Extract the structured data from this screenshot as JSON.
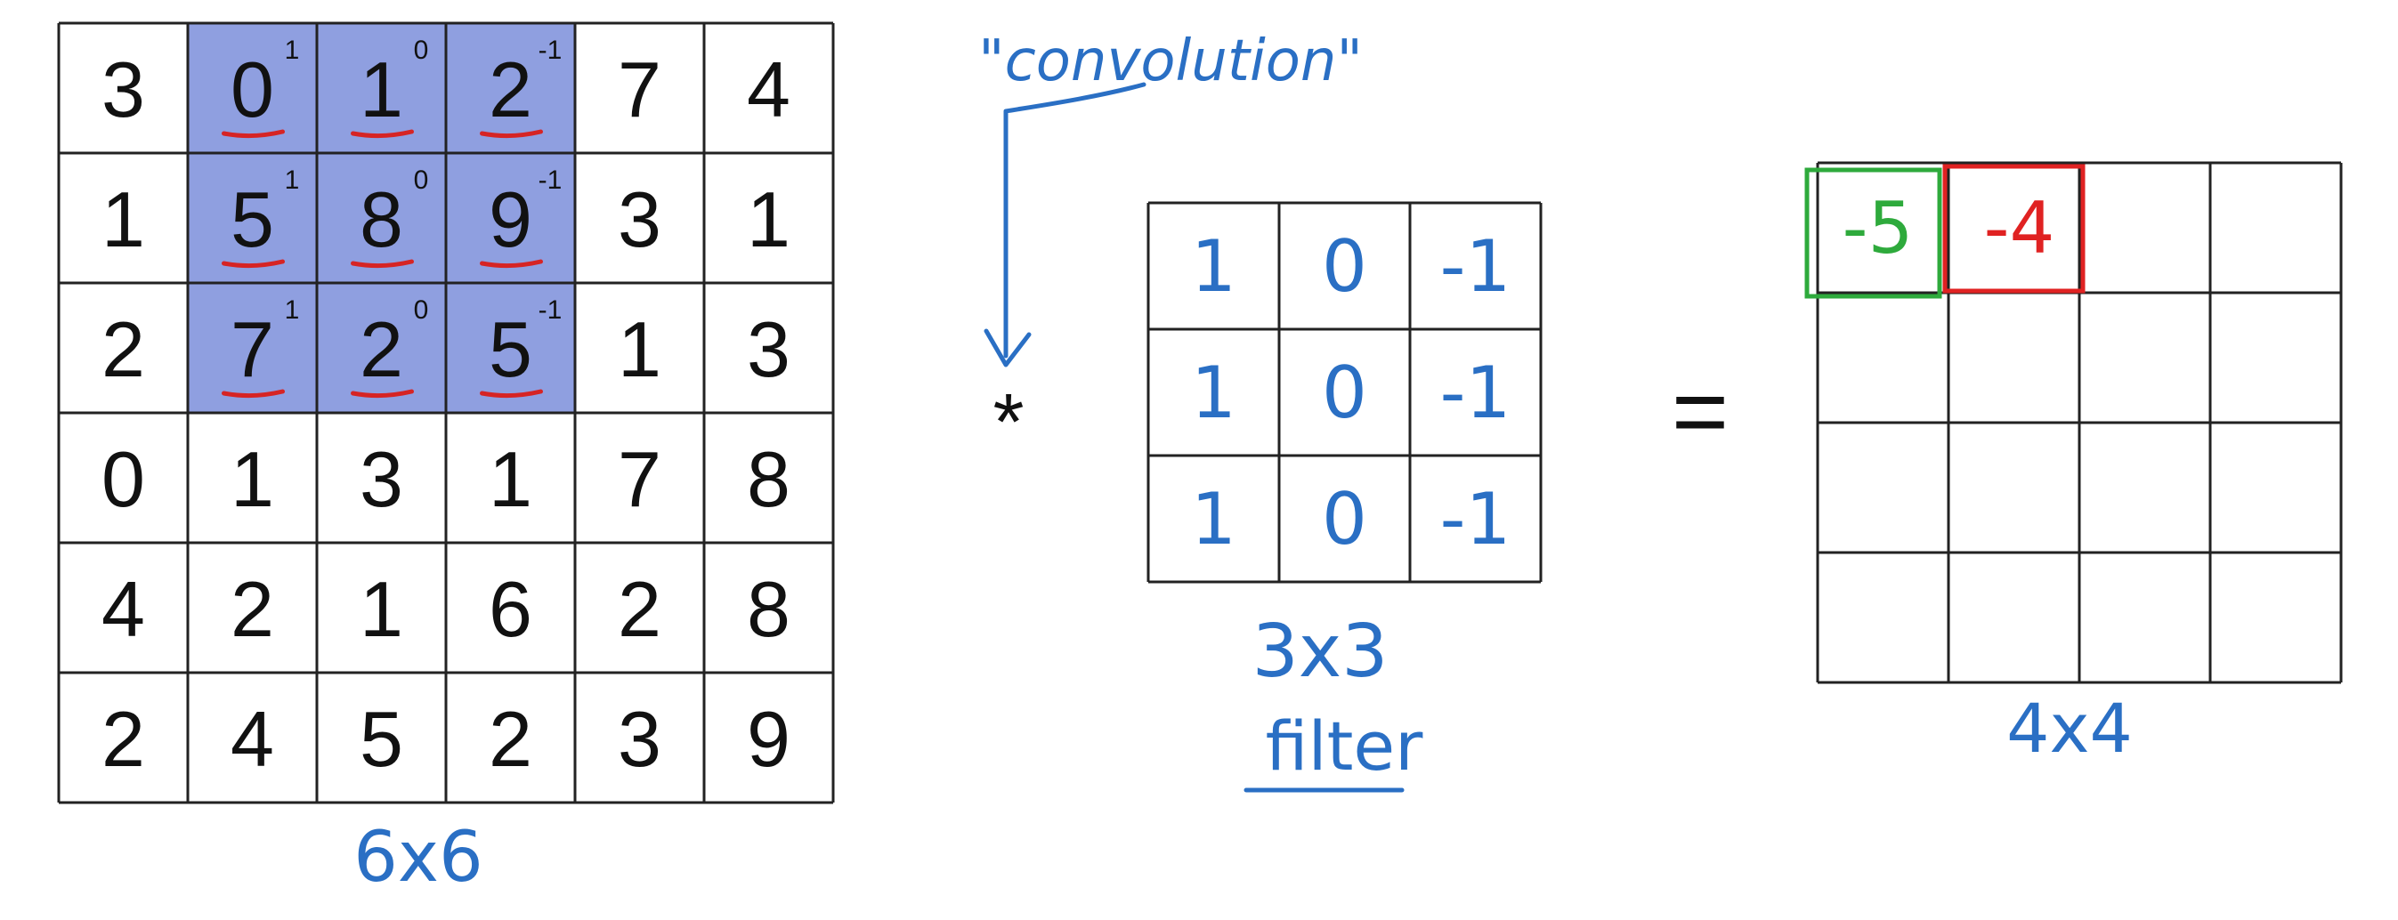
{
  "input": {
    "cells": [
      [
        "3",
        "0",
        "1",
        "2",
        "7",
        "4"
      ],
      [
        "1",
        "5",
        "8",
        "9",
        "3",
        "1"
      ],
      [
        "2",
        "7",
        "2",
        "5",
        "1",
        "3"
      ],
      [
        "0",
        "1",
        "3",
        "1",
        "7",
        "8"
      ],
      [
        "4",
        "2",
        "1",
        "6",
        "2",
        "8"
      ],
      [
        "2",
        "4",
        "5",
        "2",
        "3",
        "9"
      ]
    ],
    "highlight": {
      "row_start": 0,
      "col_start": 1,
      "size": 3
    },
    "overlay_weights": [
      [
        "1",
        "0",
        "-1"
      ],
      [
        "1",
        "0",
        "-1"
      ],
      [
        "1",
        "0",
        "-1"
      ]
    ],
    "size_label": "6x6"
  },
  "operator": "*",
  "annotation": "\"convolution\"",
  "filter": {
    "cells": [
      [
        "1",
        "0",
        "-1"
      ],
      [
        "1",
        "0",
        "-1"
      ],
      [
        "1",
        "0",
        "-1"
      ]
    ],
    "size_label": "3x3",
    "name_label": "filter"
  },
  "equals": "=",
  "output": {
    "rows": 4,
    "cols": 4,
    "values": [
      [
        "-5",
        "-4",
        "",
        ""
      ],
      [
        "",
        "",
        "",
        ""
      ],
      [
        "",
        "",
        "",
        ""
      ],
      [
        "",
        "",
        "",
        ""
      ]
    ],
    "size_label": "4x4"
  },
  "colors": {
    "grid": "#222222",
    "highlight_fill": "#8f9fe0",
    "underline": "#d62424",
    "handwriting": "#2a6fc4",
    "green": "#2eaa3c",
    "red": "#e02222",
    "text": "#111111"
  }
}
